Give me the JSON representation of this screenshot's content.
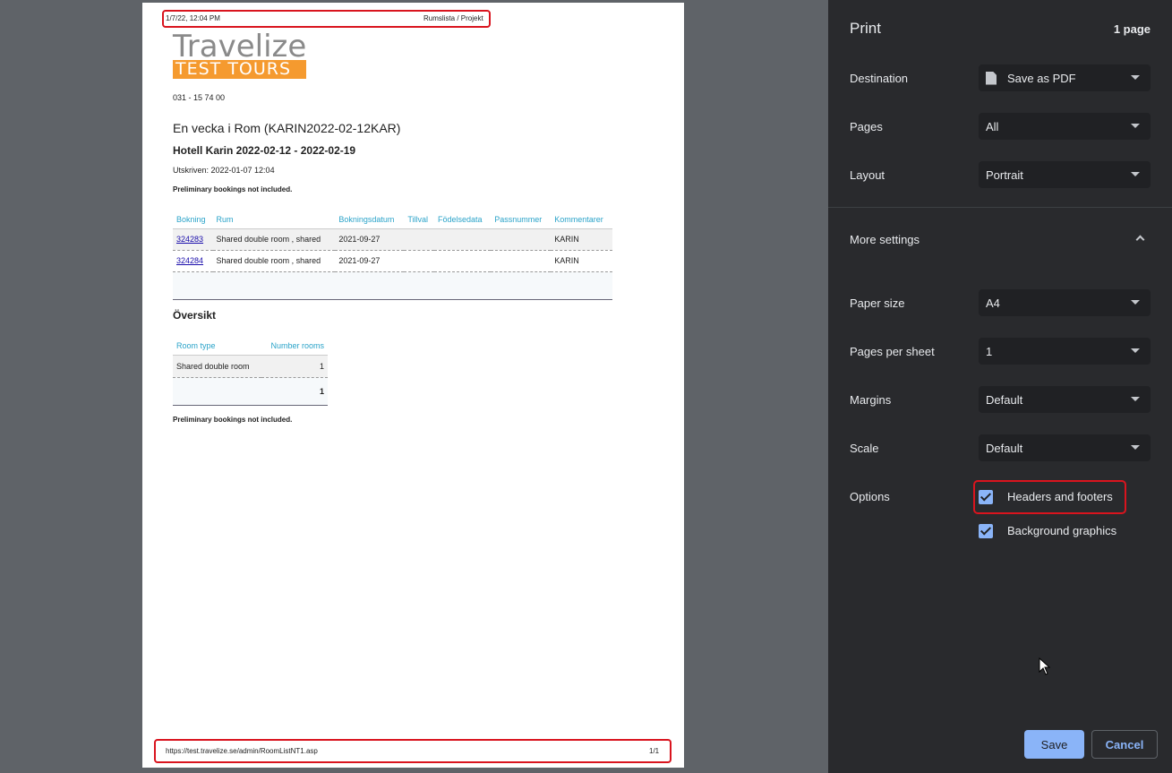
{
  "preview": {
    "header_left": "1/7/22, 12:04 PM",
    "header_right": "Rumslista / Projekt",
    "footer_left": "https://test.travelize.se/admin/RoomListNT1.asp",
    "footer_right": "1/1",
    "logo_top": "Travelize",
    "logo_bottom": "TEST TOURS",
    "phone": "031 - 15 74 00",
    "title": "En vecka i Rom (KARIN2022-02-12KAR)",
    "subtitle": "Hotell Karin 2022-02-12 - 2022-02-19",
    "printed": "Utskriven: 2022-01-07 12:04",
    "prelim_note": "Preliminary bookings not included.",
    "bookings": {
      "headers": [
        "Bokning",
        "Rum",
        "Bokningsdatum",
        "Tillval",
        "Födelsedata",
        "Passnummer",
        "Kommentarer"
      ],
      "rows": [
        [
          "324283",
          "Shared double room , shared",
          "2021-09-27",
          "",
          "",
          "",
          "KARIN"
        ],
        [
          "324284",
          "Shared double room , shared",
          "2021-09-27",
          "",
          "",
          "",
          "KARIN"
        ]
      ]
    },
    "overview_title": "Översikt",
    "overview": {
      "headers": [
        "Room type",
        "Number rooms"
      ],
      "rows": [
        [
          "Shared double room",
          "1"
        ]
      ],
      "total": "1"
    },
    "prelim_note_2": "Preliminary bookings not included."
  },
  "panel": {
    "title": "Print",
    "page_count": "1 page",
    "destination_label": "Destination",
    "destination_value": "Save as PDF",
    "pages_label": "Pages",
    "pages_value": "All",
    "layout_label": "Layout",
    "layout_value": "Portrait",
    "more_settings": "More settings",
    "paper_label": "Paper size",
    "paper_value": "A4",
    "pps_label": "Pages per sheet",
    "pps_value": "1",
    "margins_label": "Margins",
    "margins_value": "Default",
    "scale_label": "Scale",
    "scale_value": "Default",
    "options_label": "Options",
    "opt_headers": "Headers and footers",
    "opt_background": "Background graphics",
    "save": "Save",
    "cancel": "Cancel"
  },
  "colors": {
    "accent": "#8ab4f8",
    "highlight": "#d9141e",
    "panel_bg": "#292a2d",
    "logo_orange": "#f59a2f"
  }
}
